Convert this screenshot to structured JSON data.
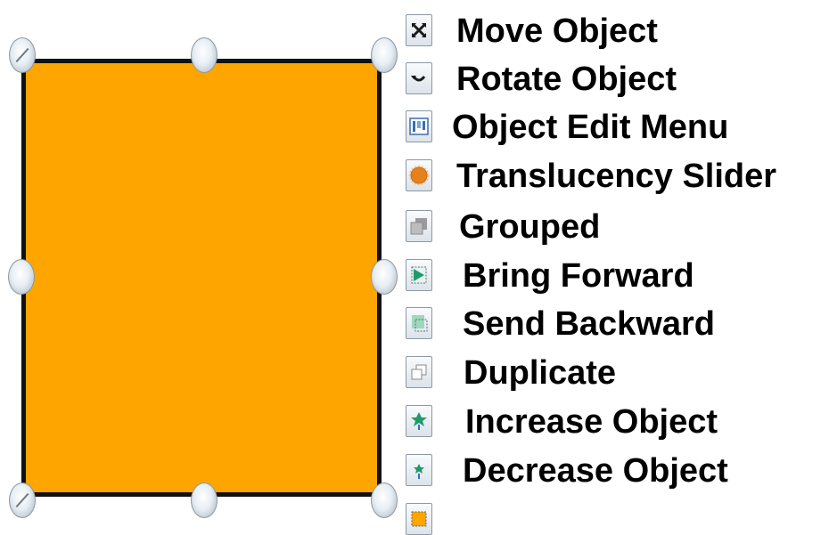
{
  "object": {
    "fill_color": "#FFA500",
    "border_color": "#111111"
  },
  "menu_items": [
    {
      "label": "Move Object",
      "icon": "move-icon"
    },
    {
      "label": "Rotate Object",
      "icon": "rotate-icon"
    },
    {
      "label": "Object Edit Menu",
      "icon": "edit-menu-icon"
    },
    {
      "label": "Translucency Slider",
      "icon": "translucency-icon"
    },
    {
      "label": "Grouped",
      "icon": "grouped-icon"
    },
    {
      "label": "Bring Forward",
      "icon": "bring-forward-icon"
    },
    {
      "label": "Send Backward",
      "icon": "send-backward-icon"
    },
    {
      "label": "Duplicate",
      "icon": "duplicate-icon"
    },
    {
      "label": "Increase Object",
      "icon": "increase-icon"
    },
    {
      "label": "Decrease Object",
      "icon": "decrease-icon"
    },
    {
      "label": "",
      "icon": "fill-color-icon"
    }
  ],
  "colors": {
    "accent_green": "#1f9a6a",
    "translucency_orange": "#e6821e"
  }
}
